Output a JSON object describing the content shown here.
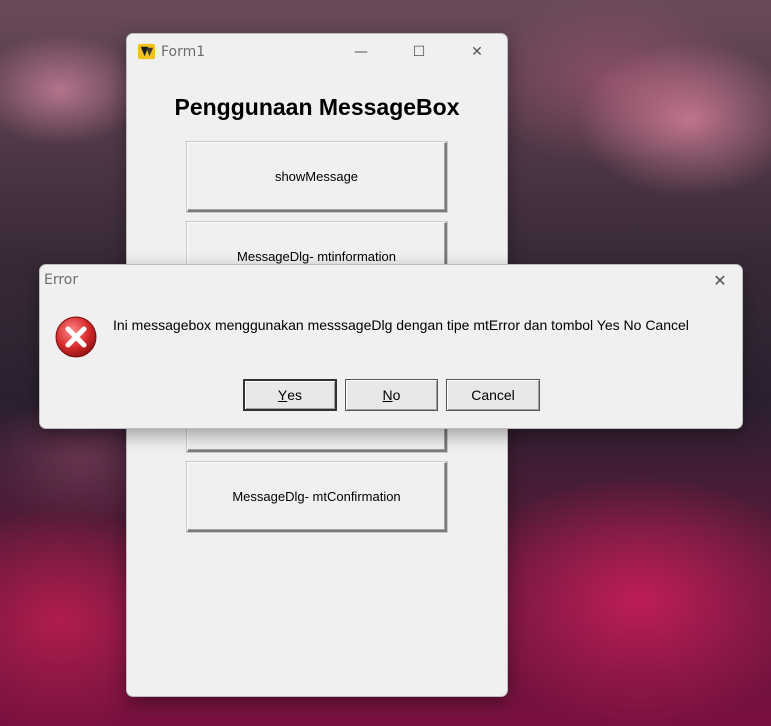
{
  "form": {
    "title": "Form1",
    "controls": {
      "minimize": "—",
      "maximize": "☐",
      "close": "✕"
    },
    "heading": "Penggunaan MessageBox",
    "buttons": [
      {
        "label": "showMessage"
      },
      {
        "label": "MessageDlg- mtinformation"
      },
      {
        "label": ""
      },
      {
        "label": "MessageDlg- mtConfirmation"
      }
    ]
  },
  "dialog": {
    "title": "Error",
    "close": "✕",
    "message": "Ini messagebox menggunakan messsageDlg dengan tipe mtError dan tombol Yes No Cancel",
    "icon": "error-icon",
    "buttons": {
      "yes_accel": "Y",
      "yes_rest": "es",
      "no_accel": "N",
      "no_rest": "o",
      "cancel": "Cancel"
    }
  },
  "colors": {
    "error_red": "#d62b2b",
    "window_bg": "#f0f0f0"
  }
}
